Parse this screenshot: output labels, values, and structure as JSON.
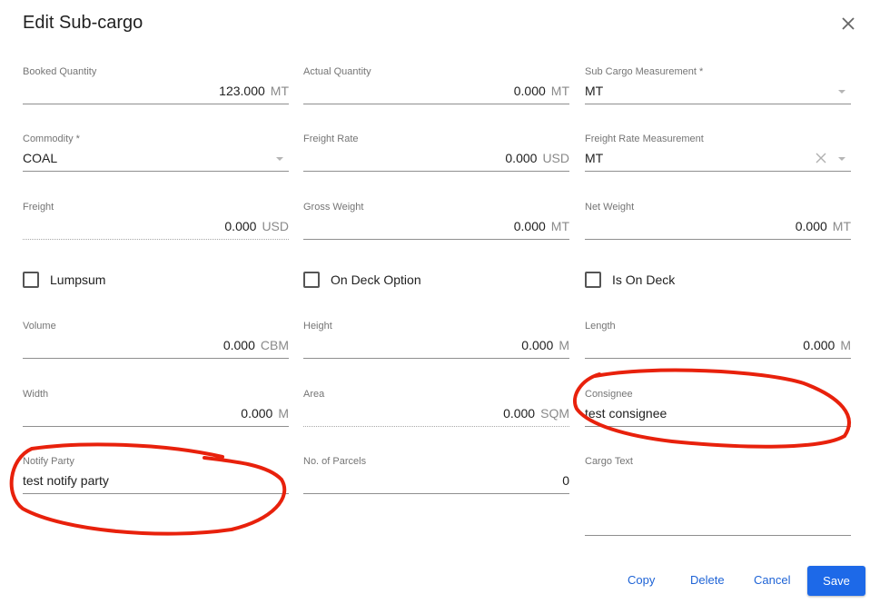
{
  "dialog": {
    "title": "Edit Sub-cargo"
  },
  "fields": {
    "booked_quantity": {
      "label": "Booked Quantity",
      "value": "123.000",
      "unit": "MT"
    },
    "actual_quantity": {
      "label": "Actual Quantity",
      "value": "0.000",
      "unit": "MT"
    },
    "sub_cargo_measurement": {
      "label": "Sub Cargo Measurement *",
      "value": "MT"
    },
    "commodity": {
      "label": "Commodity *",
      "value": "COAL"
    },
    "freight_rate": {
      "label": "Freight Rate",
      "value": "0.000",
      "unit": "USD"
    },
    "freight_rate_measurement": {
      "label": "Freight Rate Measurement",
      "value": "MT"
    },
    "freight": {
      "label": "Freight",
      "value": "0.000",
      "unit": "USD"
    },
    "gross_weight": {
      "label": "Gross Weight",
      "value": "0.000",
      "unit": "MT"
    },
    "net_weight": {
      "label": "Net Weight",
      "value": "0.000",
      "unit": "MT"
    },
    "volume": {
      "label": "Volume",
      "value": "0.000",
      "unit": "CBM"
    },
    "height": {
      "label": "Height",
      "value": "0.000",
      "unit": "M"
    },
    "length": {
      "label": "Length",
      "value": "0.000",
      "unit": "M"
    },
    "width": {
      "label": "Width",
      "value": "0.000",
      "unit": "M"
    },
    "area": {
      "label": "Area",
      "value": "0.000",
      "unit": "SQM"
    },
    "consignee": {
      "label": "Consignee",
      "value": "test consignee"
    },
    "notify_party": {
      "label": "Notify Party",
      "value": "test notify party"
    },
    "no_of_parcels": {
      "label": "No. of Parcels",
      "value": "0"
    },
    "cargo_text": {
      "label": "Cargo Text",
      "value": ""
    }
  },
  "checkboxes": {
    "lumpsum": {
      "label": "Lumpsum",
      "checked": false
    },
    "on_deck_option": {
      "label": "On Deck Option",
      "checked": false
    },
    "is_on_deck": {
      "label": "Is On Deck",
      "checked": false
    }
  },
  "actions": {
    "copy": "Copy",
    "delete": "Delete",
    "cancel": "Cancel",
    "save": "Save"
  },
  "icons": {
    "close": "close-icon",
    "dropdown": "chevron-down-icon",
    "clear": "clear-icon"
  },
  "colors": {
    "primary": "#1d69e8",
    "annotation": "#e8210c"
  }
}
